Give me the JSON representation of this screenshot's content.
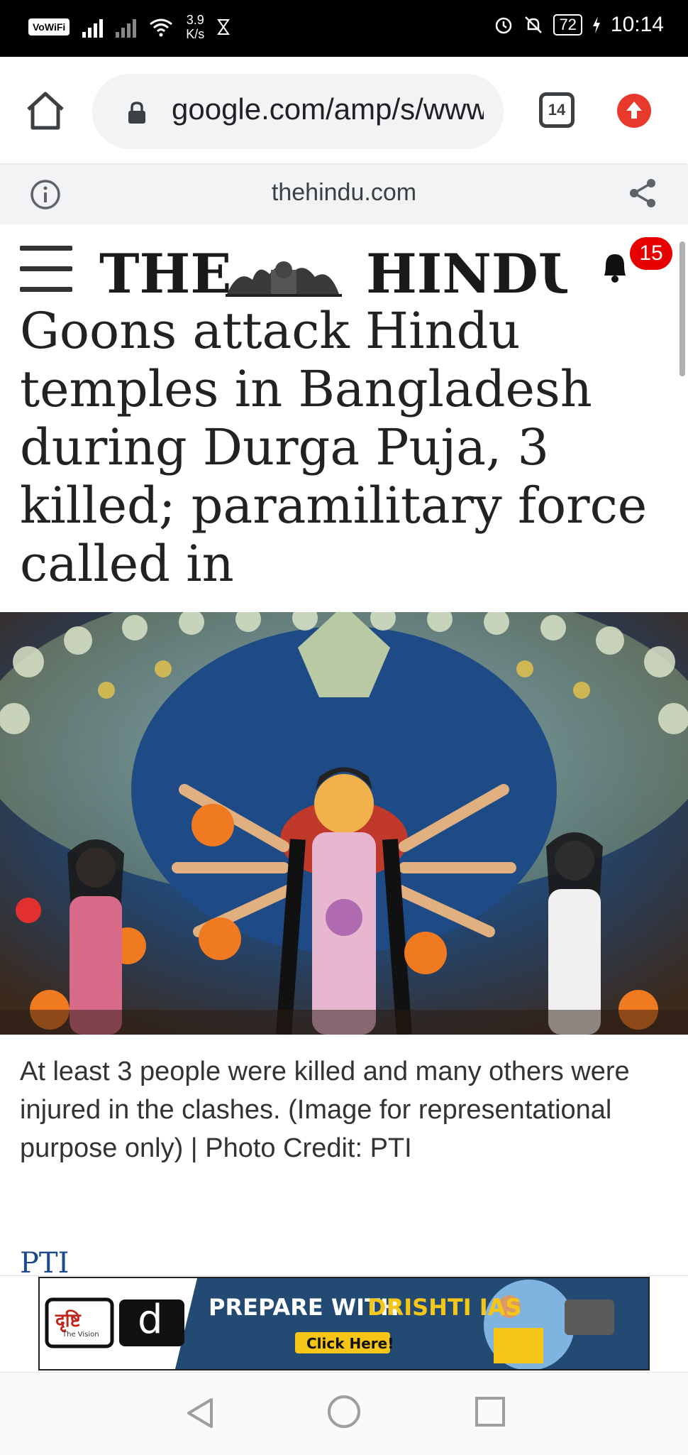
{
  "status_bar": {
    "vowifi": "VoWiFi",
    "net_speed_value": "3.9",
    "net_speed_unit": "K/s",
    "battery": "72",
    "time": "10:14"
  },
  "browser": {
    "url": "google.com/amp/s/www.thehindu.com",
    "tab_count": "14",
    "domain": "thehindu.com"
  },
  "header": {
    "logo": "THE HINDU",
    "notification_count": "15"
  },
  "article": {
    "headline": "Goons attack Hindu temples in Bangladesh during Durga Puja, 3 killed; paramilitary force called in",
    "image_caption": "At least 3 people were killed and many others were injured in the clashes. (Image for representational purpose only) | Photo Credit: PTI",
    "byline": "PTI"
  },
  "ad": {
    "brand_hindi": "दृष्टि",
    "brand_sub": "The Vision",
    "brand_letter": "d",
    "headline_part1": "PREPARE WITH ",
    "headline_part2": "DRISHTI IAS",
    "cta": "Click Here!"
  },
  "icons": [
    "home-icon",
    "lock-icon",
    "tabs-icon",
    "update-icon",
    "info-icon",
    "share-icon",
    "hamburger-icon",
    "bell-icon",
    "back-icon",
    "home-circle-icon",
    "recents-icon"
  ],
  "colors": {
    "notification_badge": "#e60000",
    "update_button": "#e8392d",
    "byline": "#1b4a8a",
    "ad_background": "#234a73",
    "ad_highlight": "#f5c518"
  }
}
